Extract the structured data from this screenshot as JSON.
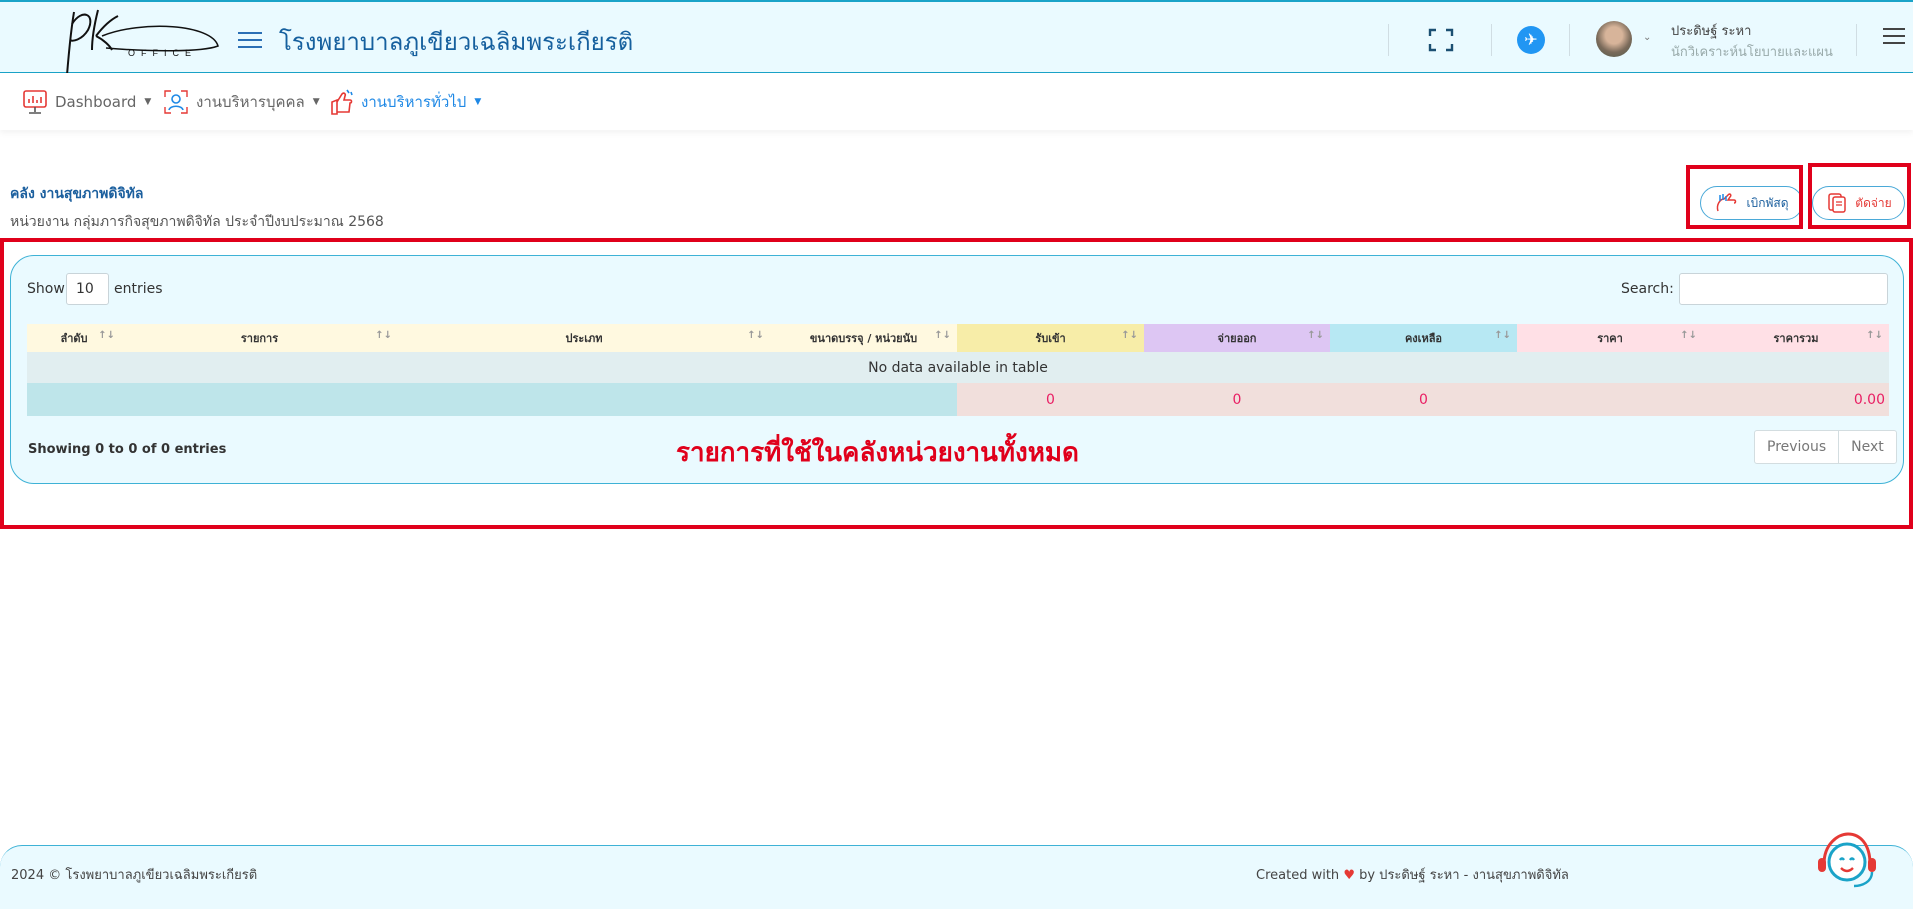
{
  "header": {
    "hospital_name": "โรงพยาบาลภูเขียวเฉลิมพระเกียรติ",
    "logo_text": "OFFICE",
    "user_name": "ประดิษฐ์ ระหา",
    "user_role": "นักวิเคราะห์นโยบายและแผน",
    "icons": [
      "menu-icon",
      "fullscreen-icon",
      "airplane-icon",
      "user-avatar",
      "menu-icon"
    ]
  },
  "nav": {
    "items": [
      {
        "label": "Dashboard",
        "icon": "dashboard-icon",
        "active": false
      },
      {
        "label": "งานบริหารบุคคล",
        "icon": "person-icon",
        "active": false
      },
      {
        "label": "งานบริหารทั่วไป",
        "icon": "hand-icon",
        "active": true
      }
    ]
  },
  "page": {
    "title": "คลัง งานสุขภาพดิจิทัล",
    "subtitle": "หน่วยงาน กลุ่มภารกิจสุขภาพดิจิทัล ประจำปีงบประมาณ 2568",
    "buttons": {
      "withdraw": "เบิกพัสดุ",
      "dispense": "ตัดจ่าย"
    },
    "annotation": "รายการที่ใช้ในคลังหน่วยงานทั้งหมด"
  },
  "table": {
    "show_label": "Show",
    "length_value": "10",
    "entries_label": "entries",
    "search_label": "Search:",
    "search_value": "",
    "columns": [
      "ลำดับ",
      "รายการ",
      "ประเภท",
      "ขนาดบรรจุ / หน่วยนับ",
      "รับเข้า",
      "จ่ายออก",
      "คงเหลือ",
      "ราคา",
      "ราคารวม"
    ],
    "empty_message": "No data available in table",
    "totals": {
      "received": "0",
      "issued": "0",
      "remaining": "0",
      "price": "",
      "total_price": "0.00"
    },
    "info": "Showing 0 to 0 of 0 entries",
    "pagination": {
      "previous": "Previous",
      "next": "Next"
    }
  },
  "footer": {
    "copyright": "2024 © โรงพยาบาลภูเขียวเฉลิมพระเกียรติ",
    "created_prefix": "Created with",
    "created_suffix": "by ประดิษฐ์ ระหา - งานสุขภาพดิจิทัล"
  },
  "colors": {
    "primary": "#16609e",
    "accent": "#1aa3c8",
    "annotation_red": "#e0001b",
    "total_red": "#e91e63"
  }
}
